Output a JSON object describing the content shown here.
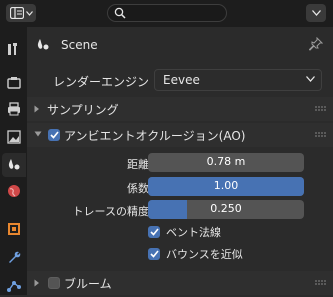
{
  "context": {
    "label": "Scene"
  },
  "render_engine": {
    "label": "レンダーエンジン",
    "value": "Eevee"
  },
  "panels": {
    "sampling": {
      "title": "サンプリング",
      "expanded": false
    },
    "ao": {
      "title": "アンビエントオクルージョン(AO)",
      "enabled": true,
      "expanded": true,
      "distance": {
        "label": "距離",
        "value": "0.78 m",
        "fill": 0.0
      },
      "factor": {
        "label": "係数",
        "value": "1.00",
        "fill": 1.0
      },
      "trace_precision": {
        "label": "トレースの精度",
        "value": "0.250",
        "fill": 0.25
      },
      "bent_normals": {
        "label": "ベント法線",
        "checked": true
      },
      "bounce_approx": {
        "label": "バウンスを近似",
        "checked": true
      }
    },
    "bloom": {
      "title": "ブルーム",
      "enabled": false,
      "expanded": false
    }
  },
  "colors": {
    "accent": "#4772b3",
    "bg": "#2b2b2b",
    "tabbar": "#1d1d1d"
  }
}
